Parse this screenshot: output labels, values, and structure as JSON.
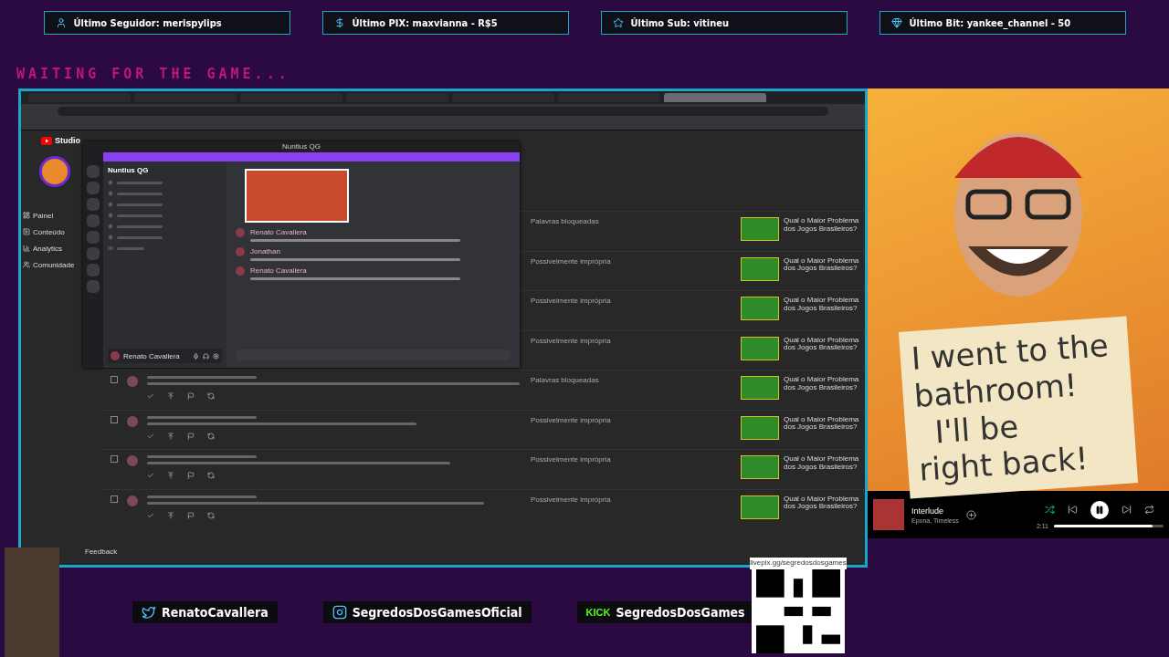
{
  "stats": [
    {
      "kind": "follower",
      "label": "Último Seguidor: merispylips"
    },
    {
      "kind": "pix",
      "label": "Último PIX: maxvianna - R$5"
    },
    {
      "kind": "sub",
      "label": "Último Sub: vitineu"
    },
    {
      "kind": "bit",
      "label": "Último Bit: yankee_channel - 50"
    }
  ],
  "status_text": "WAITING FOR THE GAME...",
  "capture": {
    "tabs": [
      {
        "selected": false
      },
      {
        "selected": false
      },
      {
        "selected": false
      },
      {
        "selected": false
      },
      {
        "selected": false
      },
      {
        "selected": false
      },
      {
        "selected": true
      }
    ],
    "studio_label": "Studio",
    "nav": [
      "Painel",
      "Conteúdo",
      "Analytics",
      "Comunidade"
    ],
    "rows": [
      {
        "status": "Palavras bloqueadas",
        "video": "Qual o Maior Problema dos Jogos Brasileiros?"
      },
      {
        "status": "Possivelmente imprópria",
        "video": "Qual o Maior Problema dos Jogos Brasileiros?"
      },
      {
        "status": "Possivelmente imprópria",
        "video": "Qual o Maior Problema dos Jogos Brasileiros?"
      },
      {
        "status": "Possivelmente imprópria",
        "video": "Qual o Maior Problema dos Jogos Brasileiros?"
      },
      {
        "checked": false,
        "status": "Palavras bloqueadas",
        "video": "Qual o Maior Problema dos Jogos Brasileiros?"
      },
      {
        "checked": false,
        "status": "Possivelmente imprópria",
        "video": "Qual o Maior Problema dos Jogos Brasileiros?"
      },
      {
        "checked": false,
        "status": "Possivelmente imprópria",
        "video": "Qual o Maior Problema dos Jogos Brasileiros?"
      },
      {
        "checked": false,
        "status": "Possivelmente imprópria",
        "video": "Qual o Maior Problema dos Jogos Brasileiros?"
      }
    ],
    "feedback": "Feedback",
    "chat_window": {
      "title": "Nuntius QG",
      "server": "Nuntius QG",
      "messages": [
        {
          "author": "Renato Cavallera"
        },
        {
          "author": "Jonathan"
        },
        {
          "author": "Renato Cavallera"
        }
      ],
      "user": "Renato Cavallera"
    }
  },
  "sign": {
    "lines": [
      "I went to the",
      "bathroom!",
      "I'll be",
      "right back!"
    ]
  },
  "socials": [
    {
      "kind": "twitter",
      "handle": "RenatoCavallera"
    },
    {
      "kind": "instagram",
      "handle": "SegredosDosGamesOficial"
    },
    {
      "kind": "kick",
      "label": "KICK",
      "handle": "SegredosDosGames"
    }
  ],
  "qr": {
    "url": "livepix.gg/segredosdosgames"
  },
  "player": {
    "title": "Interlude",
    "artist": "Epona, Timeless",
    "elapsed": "2:11",
    "level": 0.9,
    "shuffle": true,
    "playing": true
  }
}
